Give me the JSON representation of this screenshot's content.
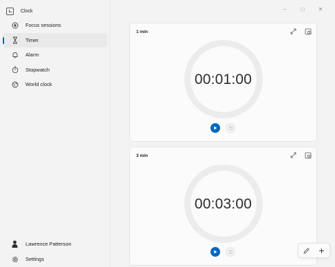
{
  "app": {
    "title": "Clock"
  },
  "nav": {
    "items": [
      {
        "label": "Focus sessions",
        "icon": "focus-icon"
      },
      {
        "label": "Timer",
        "icon": "hourglass-icon",
        "active": true
      },
      {
        "label": "Alarm",
        "icon": "bell-icon"
      },
      {
        "label": "Stopwatch",
        "icon": "stopwatch-icon"
      },
      {
        "label": "World clock",
        "icon": "globe-icon"
      }
    ]
  },
  "account": {
    "name": "Lawrence Patterson"
  },
  "settings": {
    "label": "Settings"
  },
  "window_controls": {
    "minimize": "–",
    "maximize": "□",
    "close": "✕"
  },
  "timers": [
    {
      "title": "1 min",
      "time": "00:01:00"
    },
    {
      "title": "3 min",
      "time": "00:03:00"
    }
  ],
  "colors": {
    "accent": "#0067c0",
    "background": "#f3f3f3",
    "card": "#fbfbfb",
    "ring": "#ececec"
  }
}
